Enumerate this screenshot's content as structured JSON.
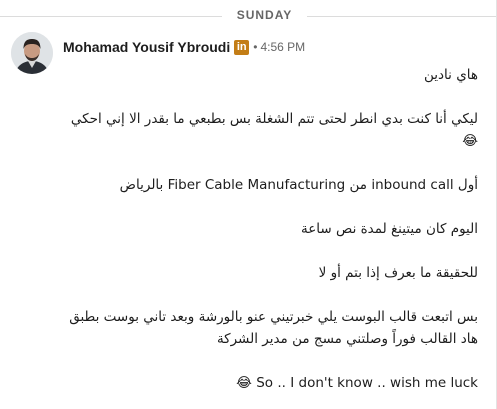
{
  "divider": {
    "label": "SUNDAY"
  },
  "sender": {
    "name": "Mohamad Yousif Ybroudi",
    "badge": "in",
    "separator": "•",
    "time": "4:56 PM"
  },
  "messages": [
    {
      "text": "هاي نادين"
    },
    {
      "text": "ليكي أنا كنت بدي انطر لحتى تتم الشغلة بس بطبعي ما بقدر الا إني احكي",
      "emoji": "😂"
    },
    {
      "text": "أول inbound call من Fiber Cable Manufacturing بالرياض"
    },
    {
      "text": "اليوم كان ميتينغ لمدة نص ساعة"
    },
    {
      "text": "للحقيقة ما بعرف إذا بتم أو لا"
    },
    {
      "text": "بس اتبعت قالب البوست يلي خبرتيني عنو بالورشة وبعد تاني بوست بطبق هاد القالب فوراً وصلتني مسج من مدير الشركة"
    },
    {
      "text": "So .. I don't know .. wish me luck",
      "emoji": "😂"
    }
  ],
  "colors": {
    "badge": "#c37d16",
    "text": "#1d1d1d",
    "muted": "#666666",
    "divider": "#dcdcdc"
  },
  "icons": {
    "avatar": "profile-photo",
    "badge": "linkedin-badge-icon"
  }
}
